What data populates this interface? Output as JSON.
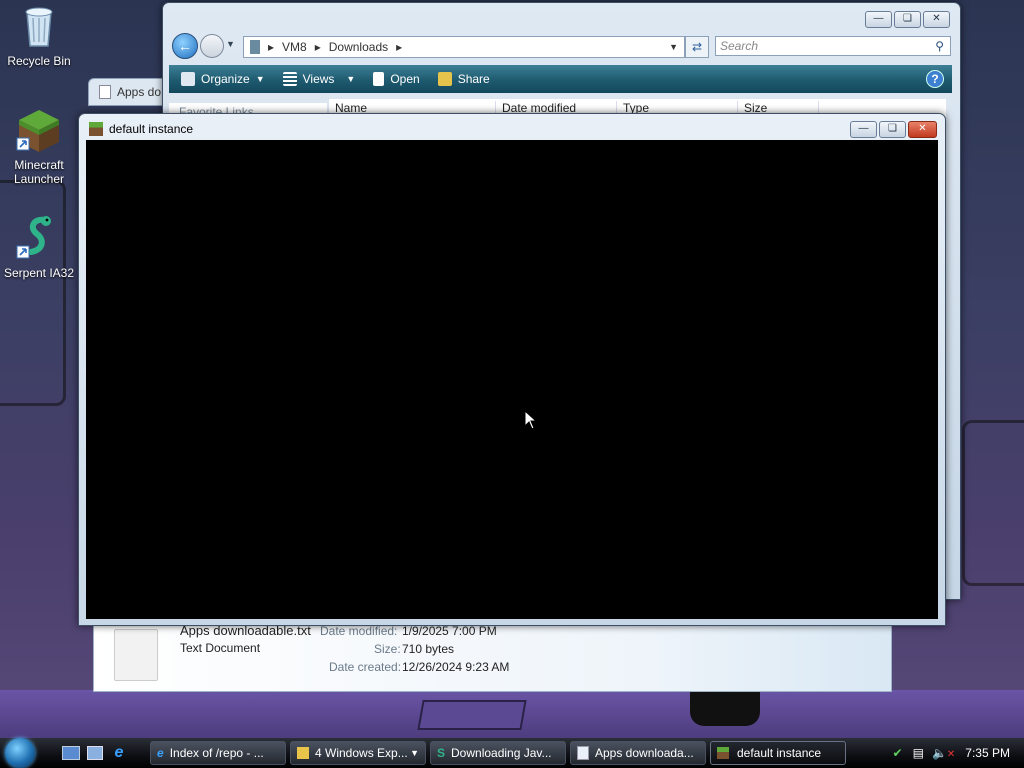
{
  "desktop": {
    "icons": [
      {
        "label": "Recycle Bin",
        "icon": "recycle-bin-icon"
      },
      {
        "label": "Minecraft Launcher",
        "icon": "minecraft-grass-block-icon"
      },
      {
        "label": "Serpent IA32",
        "icon": "serpent-icon"
      }
    ]
  },
  "explorer": {
    "breadcrumb": [
      "VM8",
      "Downloads"
    ],
    "search_placeholder": "Search",
    "toolbar": {
      "organize": "Organize",
      "views": "Views",
      "open": "Open",
      "share": "Share"
    },
    "side_tab": "Apps do",
    "favorite_links": "Favorite Links",
    "columns": [
      "Name",
      "Date modified",
      "Type",
      "Size"
    ],
    "details": {
      "file_name": "Apps downloadable.txt",
      "file_type": "Text Document",
      "date_modified_label": "Date modified:",
      "date_modified": "1/9/2025 7:00 PM",
      "size_label": "Size:",
      "size": "710 bytes",
      "date_created_label": "Date created:",
      "date_created": "12/26/2024 9:23 AM"
    }
  },
  "minecraft_window": {
    "title": "default instance"
  },
  "taskbar": {
    "tasks": [
      {
        "label": "Index of /repo - ...",
        "icon": "ie-icon"
      },
      {
        "label": "4 Windows Exp...",
        "icon": "folder-icon"
      },
      {
        "label": "Downloading Jav...",
        "icon": "serpent-icon"
      },
      {
        "label": "Apps downloada...",
        "icon": "notepad-icon"
      },
      {
        "label": "default instance",
        "icon": "minecraft-grass-block-icon"
      }
    ],
    "clock": "7:35 PM"
  }
}
